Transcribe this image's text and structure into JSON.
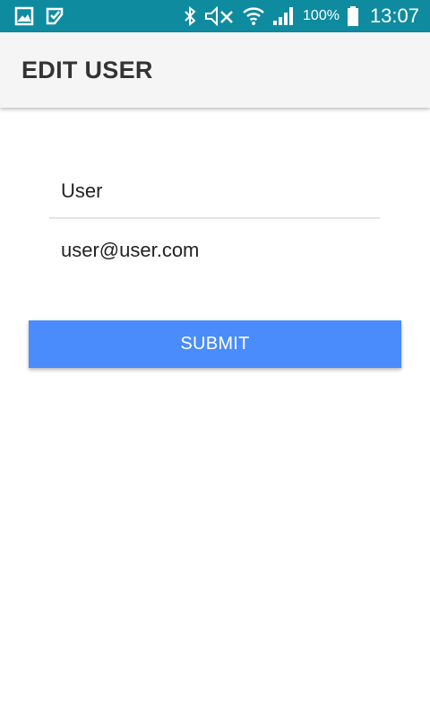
{
  "status_bar": {
    "battery": "100%",
    "time": "13:07",
    "left_icons": [
      "gallery-icon",
      "clipboard-check-icon"
    ],
    "right_icons": [
      "bluetooth-icon",
      "mute-icon",
      "wifi-icon",
      "signal-icon",
      "battery-icon"
    ],
    "background_color": "#0f8ba0"
  },
  "app_bar": {
    "title": "EDIT USER"
  },
  "form": {
    "name_value": "User",
    "email_value": "user@user.com",
    "submit_label": "SUBMIT",
    "accent_color": "#4a8cfb"
  }
}
